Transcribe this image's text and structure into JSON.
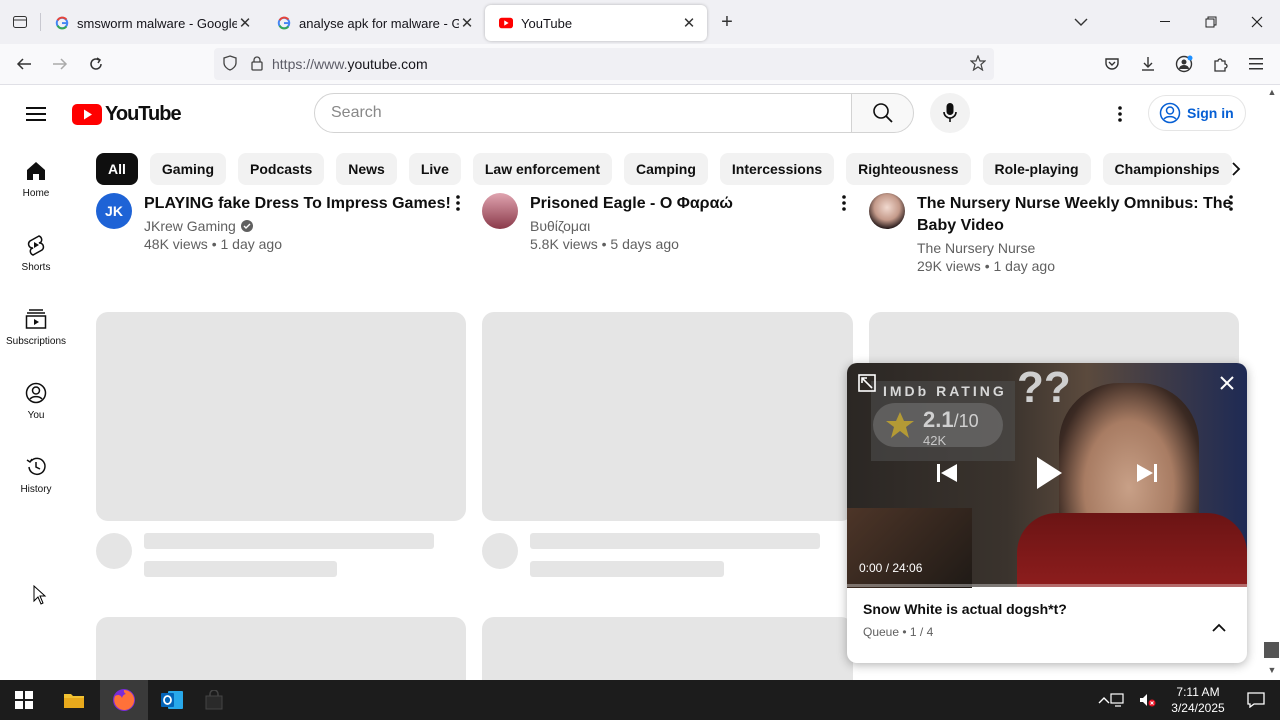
{
  "browser": {
    "tabs": [
      {
        "title": "smsworm malware - Google Se",
        "favicon": "google-g-icon"
      },
      {
        "title": "analyse apk for malware - Goog",
        "favicon": "google-g-icon"
      },
      {
        "title": "YouTube",
        "favicon": "youtube-icon",
        "active": true
      }
    ],
    "url_prefix": "https://www.",
    "url_domain": "youtube.com"
  },
  "youtube": {
    "logo_text": "YouTube",
    "search_placeholder": "Search",
    "signin_label": "Sign in",
    "sidebar": [
      {
        "label": "Home",
        "icon": "home-icon"
      },
      {
        "label": "Shorts",
        "icon": "shorts-icon"
      },
      {
        "label": "Subscriptions",
        "icon": "subscriptions-icon"
      },
      {
        "label": "You",
        "icon": "you-icon"
      },
      {
        "label": "History",
        "icon": "history-icon"
      }
    ],
    "chips": [
      "All",
      "Gaming",
      "Podcasts",
      "News",
      "Live",
      "Law enforcement",
      "Camping",
      "Intercessions",
      "Righteousness",
      "Role-playing",
      "Championships"
    ],
    "videos": [
      {
        "title": "PLAYING fake Dress To Impress Games!",
        "channel": "JKrew Gaming",
        "verified": true,
        "views": "48K views",
        "age": "1 day ago"
      },
      {
        "title": "Prisoned Eagle - Ο Φαραώ",
        "channel": "Βυθίζομαι",
        "views": "5.8K views",
        "age": "5 days ago"
      },
      {
        "title_line1": "The Nursery Nurse Weekly Omnibus: The",
        "title_line2": "Baby Video",
        "channel": "The Nursery Nurse",
        "views": "29K views",
        "age": "1 day ago"
      }
    ],
    "miniplayer": {
      "imdb_label": "IMDb RATING",
      "rating": "2.1",
      "rating_max": "/10",
      "votes": "42K",
      "overlay_text": "??",
      "time": "0:00 / 24:06",
      "progress": 0,
      "title": "Snow White is actual dogsh*t?",
      "queue": "Queue • 1 / 4"
    }
  },
  "taskbar": {
    "time": "7:11 AM",
    "date": "3/24/2025"
  },
  "colors": {
    "youtube_red": "#ff0000",
    "link_blue": "#065fd4",
    "chip_selected": "#0f0f0f"
  }
}
